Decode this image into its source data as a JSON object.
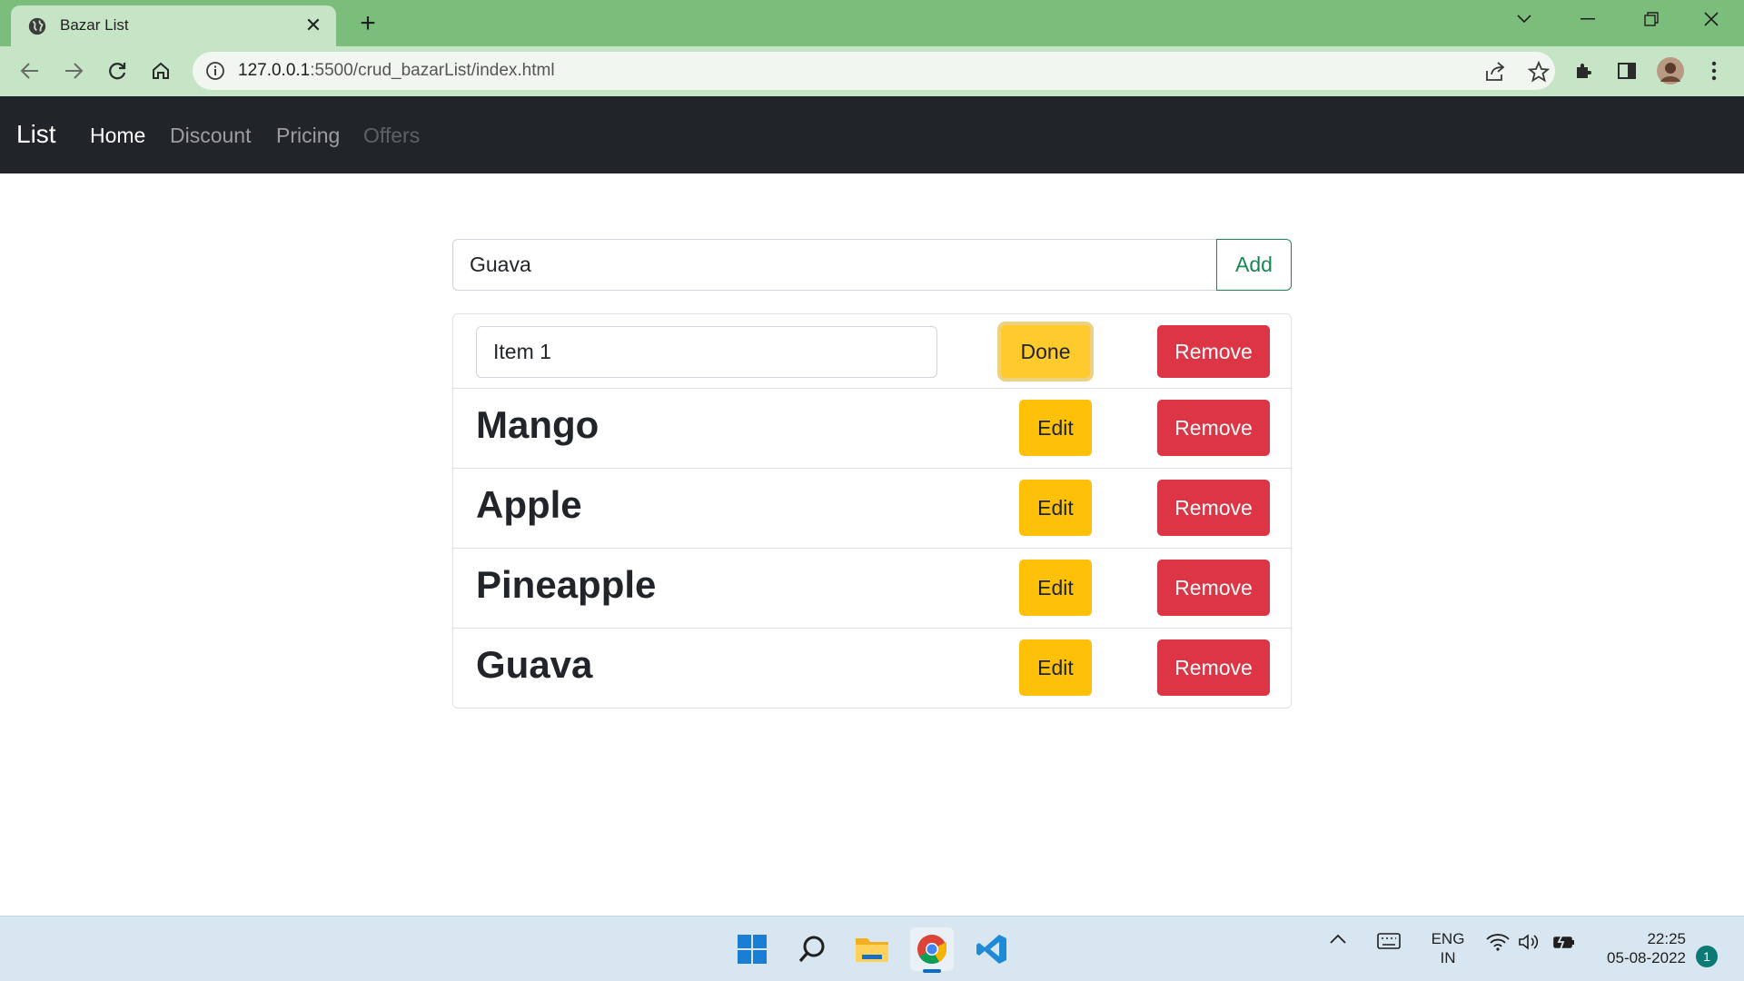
{
  "browser": {
    "tab_title": "Bazar List",
    "url_host": "127.0.0.1",
    "url_rest": ":5500/crud_bazarList/index.html"
  },
  "navbar": {
    "brand": "List",
    "links": [
      {
        "label": "Home",
        "state": "active"
      },
      {
        "label": "Discount",
        "state": "normal"
      },
      {
        "label": "Pricing",
        "state": "normal"
      },
      {
        "label": "Offers",
        "state": "disabled"
      }
    ]
  },
  "add_form": {
    "input_value": "Guava",
    "add_label": "Add"
  },
  "list": {
    "editing_row": {
      "input_value": "Item 1",
      "done_label": "Done",
      "remove_label": "Remove"
    },
    "items": [
      {
        "name": "Mango",
        "edit_label": "Edit",
        "remove_label": "Remove"
      },
      {
        "name": "Apple",
        "edit_label": "Edit",
        "remove_label": "Remove"
      },
      {
        "name": "Pineapple",
        "edit_label": "Edit",
        "remove_label": "Remove"
      },
      {
        "name": "Guava",
        "edit_label": "Edit",
        "remove_label": "Remove"
      }
    ]
  },
  "taskbar": {
    "lang_line1": "ENG",
    "lang_line2": "IN",
    "time": "22:25",
    "date": "05-08-2022",
    "notification_count": "1"
  },
  "colors": {
    "navbar_bg": "#212529",
    "success": "#198754",
    "warning": "#ffc107",
    "danger": "#dc3545",
    "tab_strip": "#7bbd7b",
    "toolbar": "#c6e4c6"
  }
}
